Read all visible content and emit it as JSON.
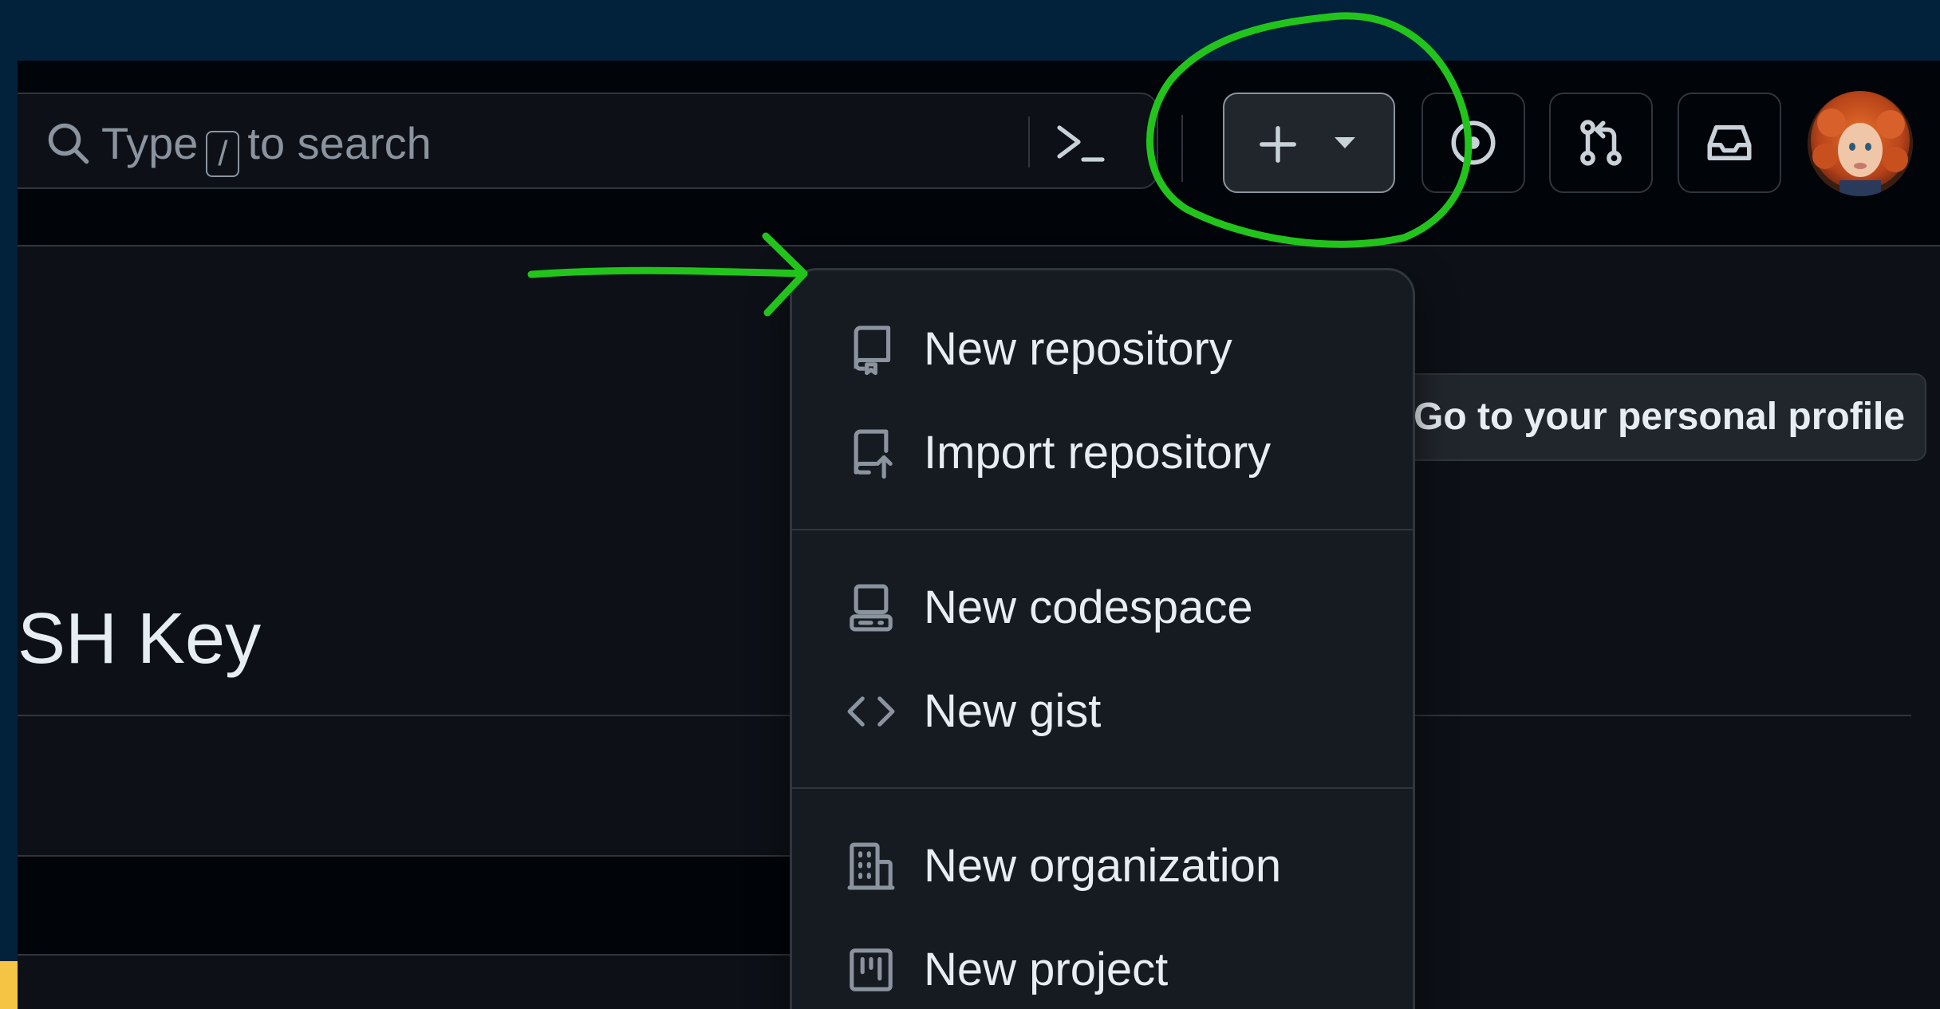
{
  "search": {
    "text_before": "Type",
    "key": "/",
    "text_after": "to search",
    "icon": "search-icon",
    "command_icon": "command-palette-icon"
  },
  "header_buttons": {
    "create": {
      "icon": "plus-icon",
      "caret": "triangle-down-icon"
    },
    "issues": {
      "icon": "issue-opened-icon"
    },
    "pull_requests": {
      "icon": "git-pull-request-icon"
    },
    "inbox": {
      "icon": "inbox-icon"
    },
    "avatar": {
      "icon": "avatar-image"
    }
  },
  "create_menu": {
    "groups": [
      [
        {
          "label": "New repository",
          "icon": "repo-icon"
        },
        {
          "label": "Import repository",
          "icon": "repo-push-icon"
        }
      ],
      [
        {
          "label": "New codespace",
          "icon": "codespaces-icon"
        },
        {
          "label": "New gist",
          "icon": "code-icon"
        }
      ],
      [
        {
          "label": "New organization",
          "icon": "organization-icon"
        },
        {
          "label": "New project",
          "icon": "project-icon"
        }
      ]
    ]
  },
  "page": {
    "profile_button": "Go to your personal profile",
    "title_partial": "SH Key"
  },
  "colors": {
    "frame_bg": "#02213a",
    "header_bg": "#010409",
    "page_bg": "#0d1117",
    "menu_bg": "#161b22",
    "border": "#30363d",
    "text": "#e6edf3",
    "muted": "#8b949e",
    "annotation_green": "#22c41c",
    "accent_yellow": "#f6c445"
  }
}
